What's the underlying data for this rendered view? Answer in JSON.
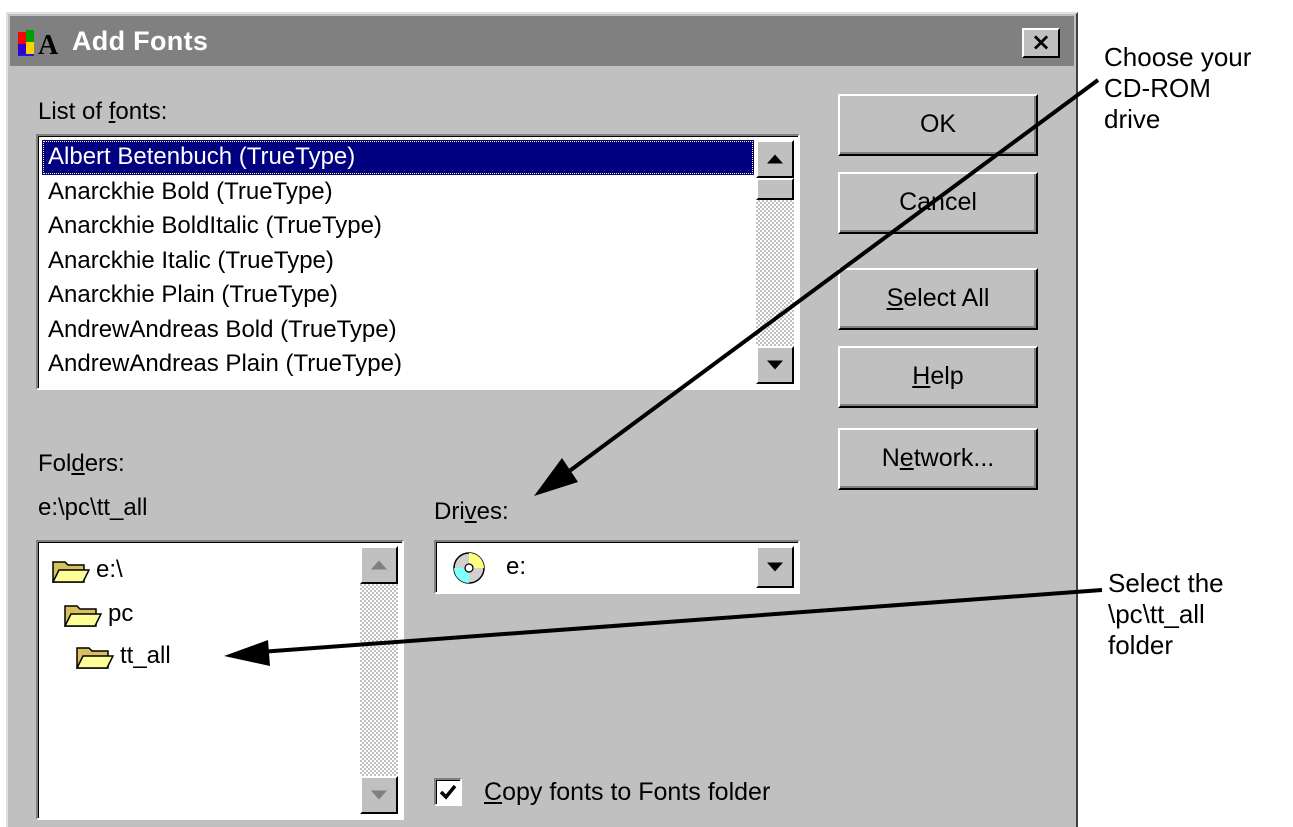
{
  "window": {
    "title": "Add Fonts",
    "close_label": "×"
  },
  "font_list": {
    "label_pre": "List of ",
    "label_u": "f",
    "label_post": "onts:",
    "items": [
      {
        "label": "Albert Betenbuch (TrueType)"
      },
      {
        "label": "Anarckhie Bold (TrueType)"
      },
      {
        "label": "Anarckhie BoldItalic (TrueType)"
      },
      {
        "label": "Anarckhie Italic (TrueType)"
      },
      {
        "label": "Anarckhie Plain (TrueType)"
      },
      {
        "label": "AndrewAndreas Bold (TrueType)"
      },
      {
        "label": "AndrewAndreas Plain (TrueType)"
      }
    ],
    "selected_index": 0
  },
  "buttons": {
    "ok": "OK",
    "cancel": "Cancel",
    "select_all_u": "S",
    "select_all_rest": "elect All",
    "help_u": "H",
    "help_rest": "elp",
    "network_pre": "N",
    "network_u": "e",
    "network_post": "twork..."
  },
  "folders": {
    "label_pre": "Fol",
    "label_u": "d",
    "label_post": "ers:",
    "path": "e:\\pc\\tt_all",
    "items": [
      {
        "label": "e:\\"
      },
      {
        "label": "pc"
      },
      {
        "label": "tt_all"
      }
    ]
  },
  "drives": {
    "label_pre": "Dri",
    "label_u": "v",
    "label_post": "es:",
    "value": "e:",
    "icon": "cd-drive-icon"
  },
  "copy_option": {
    "u": "C",
    "rest": "opy fonts to Fonts folder",
    "checked": true
  },
  "annotations": {
    "drive_note": "Choose your\nCD-ROM\ndrive",
    "folder_note": "Select the\n\\pc\\tt_all\nfolder"
  },
  "colors": {
    "dialog_face": "#c0c0c0",
    "titlebar": "#808080",
    "selection": "#000080"
  }
}
